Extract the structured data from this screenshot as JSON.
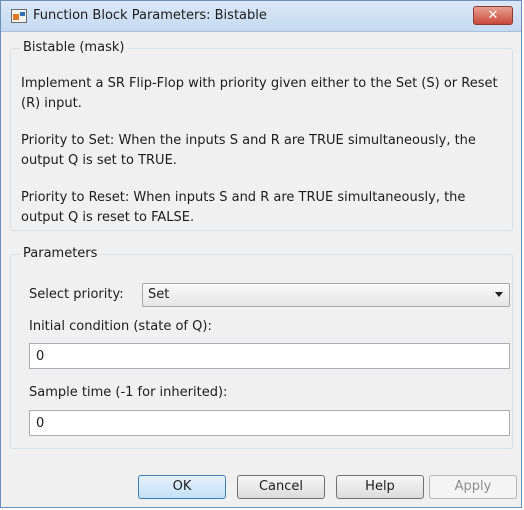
{
  "window": {
    "title": "Function Block Parameters: Bistable"
  },
  "mask_group": {
    "title": "Bistable (mask)",
    "description_1": "Implement a SR Flip-Flop with priority given either to the Set (S) or Reset (R) input.",
    "description_2": "Priority to Set: When the inputs S and R are TRUE simultaneously, the output Q is set to TRUE.",
    "description_3": "Priority to Reset: When inputs S and R are TRUE simultaneously, the output Q is reset to FALSE."
  },
  "parameters": {
    "title": "Parameters",
    "priority_label": "Select priority:",
    "priority_value": "Set",
    "initial_condition_label": "Initial condition (state of Q):",
    "initial_condition_value": "0",
    "sample_time_label": "Sample time (-1 for inherited):",
    "sample_time_value": "0"
  },
  "buttons": {
    "ok": "OK",
    "cancel": "Cancel",
    "help": "Help",
    "apply": "Apply"
  },
  "icons": {
    "app": "simulink-block-icon",
    "close": "close-icon",
    "dropdown": "chevron-down-icon"
  },
  "colors": {
    "title_bar": "#c5d9f1",
    "close_button": "#c9483b",
    "primary_button": "#c4dff6"
  }
}
